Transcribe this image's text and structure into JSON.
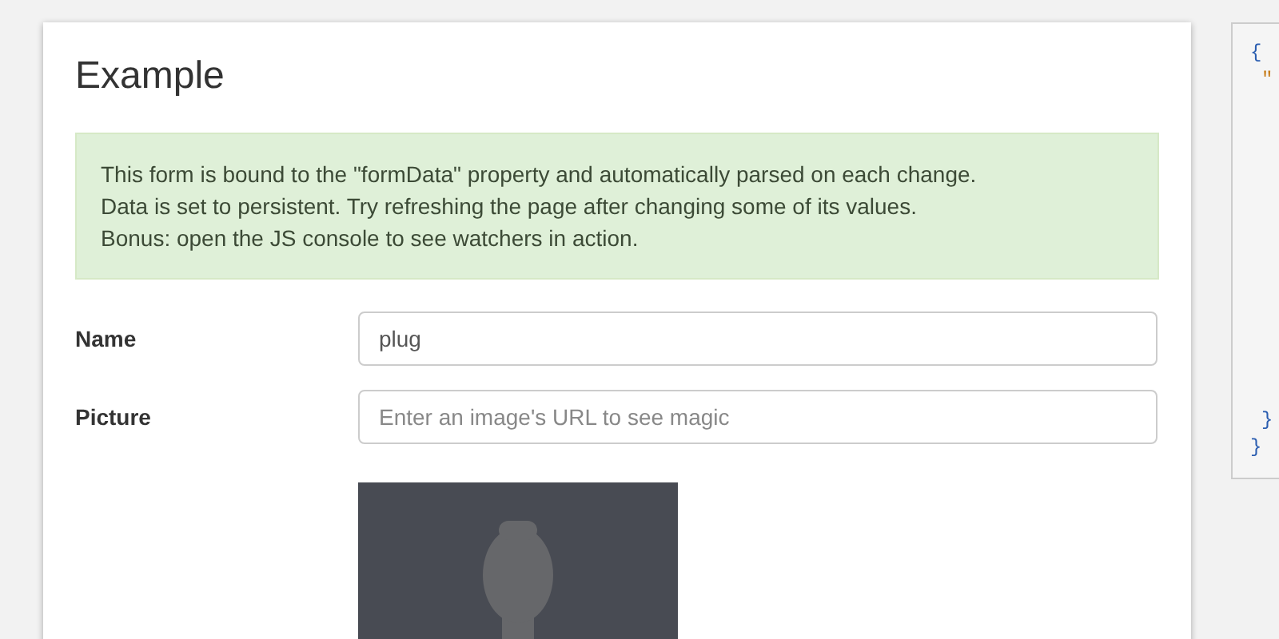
{
  "card": {
    "title": "Example",
    "alert": [
      "This form is bound to the \"formData\" property and automatically parsed on each change.",
      "Data is set to persistent. Try refreshing the page after changing some of its values.",
      "Bonus: open the JS console to see watchers in action."
    ],
    "fields": [
      {
        "label": "Name",
        "value": "plug"
      },
      {
        "label": "Picture",
        "placeholder": "Enter an image's URL to see magic"
      }
    ]
  },
  "code_panel": {
    "open": "{",
    "body": [
      {
        "text": "\""
      },
      {
        "text": "}"
      }
    ],
    "close": "}"
  }
}
